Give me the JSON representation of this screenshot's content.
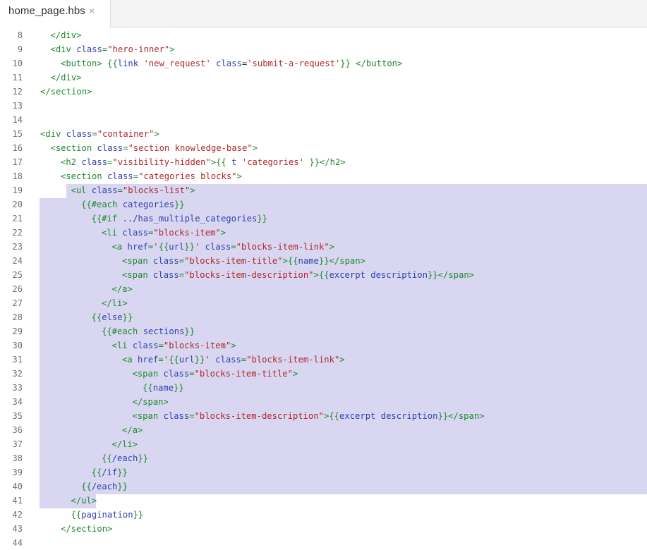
{
  "tab": {
    "label": "home_page.hbs",
    "close_icon": "×"
  },
  "editor": {
    "lines": [
      {
        "n": "8",
        "indent": 1,
        "t": [
          [
            "tag",
            "</div>"
          ]
        ]
      },
      {
        "n": "9",
        "indent": 1,
        "t": [
          [
            "tag",
            "<div "
          ],
          [
            "attr",
            "class"
          ],
          [
            "tag",
            "="
          ],
          [
            "str",
            "\"hero-inner\""
          ],
          [
            "tag",
            ">"
          ]
        ]
      },
      {
        "n": "10",
        "indent": 2,
        "t": [
          [
            "tag",
            "<button> "
          ],
          [
            "hb",
            "{{"
          ],
          [
            "hid",
            "link"
          ],
          [
            "txt",
            " "
          ],
          [
            "str",
            "'new_request'"
          ],
          [
            "txt",
            " "
          ],
          [
            "attr",
            "class"
          ],
          [
            "txt",
            "="
          ],
          [
            "str",
            "'submit-a-request'"
          ],
          [
            "hb",
            "}}"
          ],
          [
            "tag",
            " </button>"
          ]
        ]
      },
      {
        "n": "11",
        "indent": 1,
        "t": [
          [
            "tag",
            "</div>"
          ]
        ]
      },
      {
        "n": "12",
        "indent": 0,
        "t": [
          [
            "tag",
            "</section>"
          ]
        ]
      },
      {
        "n": "13",
        "indent": 0,
        "t": []
      },
      {
        "n": "14",
        "indent": 0,
        "t": []
      },
      {
        "n": "15",
        "indent": 0,
        "t": [
          [
            "tag",
            "<div "
          ],
          [
            "attr",
            "class"
          ],
          [
            "tag",
            "="
          ],
          [
            "str",
            "\"container\""
          ],
          [
            "tag",
            ">"
          ]
        ]
      },
      {
        "n": "16",
        "indent": 1,
        "t": [
          [
            "tag",
            "<section "
          ],
          [
            "attr",
            "class"
          ],
          [
            "tag",
            "="
          ],
          [
            "str",
            "\"section knowledge-base\""
          ],
          [
            "tag",
            ">"
          ]
        ]
      },
      {
        "n": "17",
        "indent": 2,
        "t": [
          [
            "tag",
            "<h2 "
          ],
          [
            "attr",
            "class"
          ],
          [
            "tag",
            "="
          ],
          [
            "str",
            "\"visibility-hidden\""
          ],
          [
            "tag",
            ">"
          ],
          [
            "hb",
            "{{ "
          ],
          [
            "hid",
            "t"
          ],
          [
            "txt",
            " "
          ],
          [
            "str",
            "'categories'"
          ],
          [
            "hb",
            " }}"
          ],
          [
            "tag",
            "</h2>"
          ]
        ]
      },
      {
        "n": "18",
        "indent": 2,
        "t": [
          [
            "tag",
            "<section "
          ],
          [
            "attr",
            "class"
          ],
          [
            "tag",
            "="
          ],
          [
            "str",
            "\"categories blocks\""
          ],
          [
            "tag",
            ">"
          ]
        ]
      },
      {
        "n": "19",
        "indent": 3,
        "t": [
          [
            "tag",
            "<ul "
          ],
          [
            "attr",
            "class"
          ],
          [
            "tag",
            "="
          ],
          [
            "str",
            "\"blocks-list\""
          ],
          [
            "tag",
            ">"
          ]
        ]
      },
      {
        "n": "20",
        "indent": 4,
        "t": [
          [
            "hb",
            "{{#each "
          ],
          [
            "hid",
            "categories"
          ],
          [
            "hb",
            "}}"
          ]
        ]
      },
      {
        "n": "21",
        "indent": 5,
        "t": [
          [
            "hb",
            "{{#if "
          ],
          [
            "hid",
            "../has_multiple_categories"
          ],
          [
            "hb",
            "}}"
          ]
        ]
      },
      {
        "n": "22",
        "indent": 6,
        "t": [
          [
            "tag",
            "<li "
          ],
          [
            "attr",
            "class"
          ],
          [
            "tag",
            "="
          ],
          [
            "str",
            "\"blocks-item\""
          ],
          [
            "tag",
            ">"
          ]
        ]
      },
      {
        "n": "23",
        "indent": 7,
        "t": [
          [
            "tag",
            "<a "
          ],
          [
            "attr",
            "href"
          ],
          [
            "tag",
            "="
          ],
          [
            "str",
            "'"
          ],
          [
            "hb",
            "{{"
          ],
          [
            "hid",
            "url"
          ],
          [
            "hb",
            "}}"
          ],
          [
            "str",
            "'"
          ],
          [
            "txt",
            " "
          ],
          [
            "attr",
            "class"
          ],
          [
            "tag",
            "="
          ],
          [
            "str",
            "\"blocks-item-link\""
          ],
          [
            "tag",
            ">"
          ]
        ]
      },
      {
        "n": "24",
        "indent": 8,
        "t": [
          [
            "tag",
            "<span "
          ],
          [
            "attr",
            "class"
          ],
          [
            "tag",
            "="
          ],
          [
            "str",
            "\"blocks-item-title\""
          ],
          [
            "tag",
            ">"
          ],
          [
            "hb",
            "{{"
          ],
          [
            "hid",
            "name"
          ],
          [
            "hb",
            "}}"
          ],
          [
            "tag",
            "</span>"
          ]
        ]
      },
      {
        "n": "25",
        "indent": 8,
        "t": [
          [
            "tag",
            "<span "
          ],
          [
            "attr",
            "class"
          ],
          [
            "tag",
            "="
          ],
          [
            "str",
            "\"blocks-item-description\""
          ],
          [
            "tag",
            ">"
          ],
          [
            "hb",
            "{{"
          ],
          [
            "hid",
            "excerpt description"
          ],
          [
            "hb",
            "}}"
          ],
          [
            "tag",
            "</span>"
          ]
        ]
      },
      {
        "n": "26",
        "indent": 7,
        "t": [
          [
            "tag",
            "</a>"
          ]
        ]
      },
      {
        "n": "27",
        "indent": 6,
        "t": [
          [
            "tag",
            "</li>"
          ]
        ]
      },
      {
        "n": "28",
        "indent": 5,
        "t": [
          [
            "hb",
            "{{"
          ],
          [
            "hid",
            "else"
          ],
          [
            "hb",
            "}}"
          ]
        ]
      },
      {
        "n": "29",
        "indent": 6,
        "t": [
          [
            "hb",
            "{{#each "
          ],
          [
            "hid",
            "sections"
          ],
          [
            "hb",
            "}}"
          ]
        ]
      },
      {
        "n": "30",
        "indent": 7,
        "t": [
          [
            "tag",
            "<li "
          ],
          [
            "attr",
            "class"
          ],
          [
            "tag",
            "="
          ],
          [
            "str",
            "\"blocks-item\""
          ],
          [
            "tag",
            ">"
          ]
        ]
      },
      {
        "n": "31",
        "indent": 8,
        "t": [
          [
            "tag",
            "<a "
          ],
          [
            "attr",
            "href"
          ],
          [
            "tag",
            "="
          ],
          [
            "str",
            "'"
          ],
          [
            "hb",
            "{{"
          ],
          [
            "hid",
            "url"
          ],
          [
            "hb",
            "}}"
          ],
          [
            "str",
            "'"
          ],
          [
            "txt",
            " "
          ],
          [
            "attr",
            "class"
          ],
          [
            "tag",
            "="
          ],
          [
            "str",
            "\"blocks-item-link\""
          ],
          [
            "tag",
            ">"
          ]
        ]
      },
      {
        "n": "32",
        "indent": 9,
        "t": [
          [
            "tag",
            "<span "
          ],
          [
            "attr",
            "class"
          ],
          [
            "tag",
            "="
          ],
          [
            "str",
            "\"blocks-item-title\""
          ],
          [
            "tag",
            ">"
          ]
        ]
      },
      {
        "n": "33",
        "indent": 10,
        "t": [
          [
            "hb",
            "{{"
          ],
          [
            "hid",
            "name"
          ],
          [
            "hb",
            "}}"
          ]
        ]
      },
      {
        "n": "34",
        "indent": 9,
        "t": [
          [
            "tag",
            "</span>"
          ]
        ]
      },
      {
        "n": "35",
        "indent": 9,
        "t": [
          [
            "tag",
            "<span "
          ],
          [
            "attr",
            "class"
          ],
          [
            "tag",
            "="
          ],
          [
            "str",
            "\"blocks-item-description\""
          ],
          [
            "tag",
            ">"
          ],
          [
            "hb",
            "{{"
          ],
          [
            "hid",
            "excerpt description"
          ],
          [
            "hb",
            "}}"
          ],
          [
            "tag",
            "</span>"
          ]
        ]
      },
      {
        "n": "36",
        "indent": 8,
        "t": [
          [
            "tag",
            "</a>"
          ]
        ]
      },
      {
        "n": "37",
        "indent": 7,
        "t": [
          [
            "tag",
            "</li>"
          ]
        ]
      },
      {
        "n": "38",
        "indent": 6,
        "t": [
          [
            "hb",
            "{{"
          ],
          [
            "hid",
            "/each"
          ],
          [
            "hb",
            "}}"
          ]
        ]
      },
      {
        "n": "39",
        "indent": 5,
        "t": [
          [
            "hb",
            "{{"
          ],
          [
            "hid",
            "/if"
          ],
          [
            "hb",
            "}}"
          ]
        ]
      },
      {
        "n": "40",
        "indent": 4,
        "t": [
          [
            "hb",
            "{{"
          ],
          [
            "hid",
            "/each"
          ],
          [
            "hb",
            "}}"
          ]
        ]
      },
      {
        "n": "41",
        "indent": 3,
        "t": [
          [
            "tag",
            "</ul>"
          ]
        ]
      },
      {
        "n": "42",
        "indent": 3,
        "t": [
          [
            "hb",
            "{{"
          ],
          [
            "hid",
            "pagination"
          ],
          [
            "hb",
            "}}"
          ]
        ]
      },
      {
        "n": "43",
        "indent": 2,
        "t": [
          [
            "tag",
            "</section>"
          ]
        ]
      },
      {
        "n": "44",
        "indent": 0,
        "t": []
      }
    ]
  },
  "colors": {
    "tag": "#1f8a2e",
    "attr": "#3341ad",
    "string": "#b0282c",
    "handlebars": "#1f8a2e",
    "identifier": "#3341ad",
    "selection": "#d8d6f1",
    "line_number": "#6e6e6e"
  }
}
